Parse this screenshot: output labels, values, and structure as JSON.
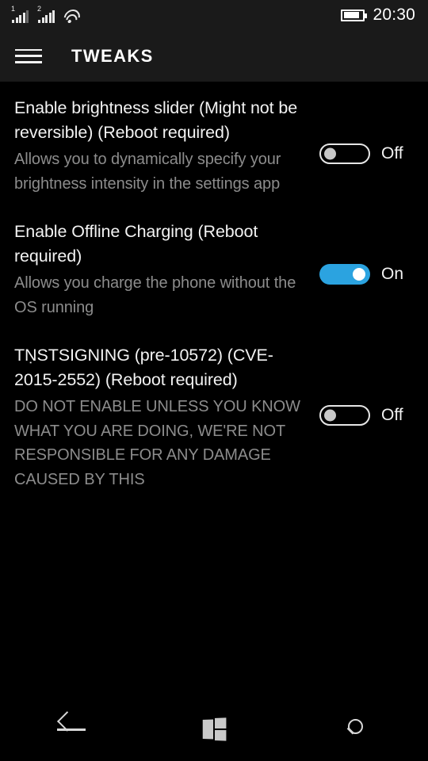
{
  "status_bar": {
    "sim1": {
      "label": "1",
      "bars_filled": 4,
      "bars_total": 5
    },
    "sim2": {
      "label": "2",
      "bars_filled": 5,
      "bars_total": 5
    },
    "wifi": "wifi-icon",
    "battery": {
      "icon": "battery-icon",
      "level_percent": 84
    },
    "clock": "20:30"
  },
  "header": {
    "menu_icon": "hamburger-menu-icon",
    "title": "TWEAKS"
  },
  "settings": [
    {
      "title": "Enable brightness slider (Might not be reversible) (Reboot required)",
      "description": "Allows you to dynamically specify your brightness intensity in the settings app",
      "toggle_state": "off",
      "state_label": "Off"
    },
    {
      "title": "Enable Offline Charging (Reboot required)",
      "description": "Allows you charge the phone without the OS running",
      "toggle_state": "on",
      "state_label": "On"
    },
    {
      "title": "TṆSTSIGNING (pre-10572) (CVE-2015-2552) (Reboot required)",
      "description": "DO NOT ENABLE UNLESS YOU KNOW WHAT YOU ARE DOING, WE'RE NOT RESPONSIBLE FOR ANY DAMAGE CAUSED BY THIS",
      "toggle_state": "off",
      "state_label": "Off"
    }
  ],
  "nav_bar": {
    "back": "back-arrow-icon",
    "start": "windows-logo-icon",
    "search": "search-icon"
  },
  "colors": {
    "accent_blue": "#2ba3e0",
    "header_background": "#1a1a1a",
    "page_background": "#000000",
    "title_text": "#f2f2f2",
    "description_text": "#8c8c8c"
  }
}
